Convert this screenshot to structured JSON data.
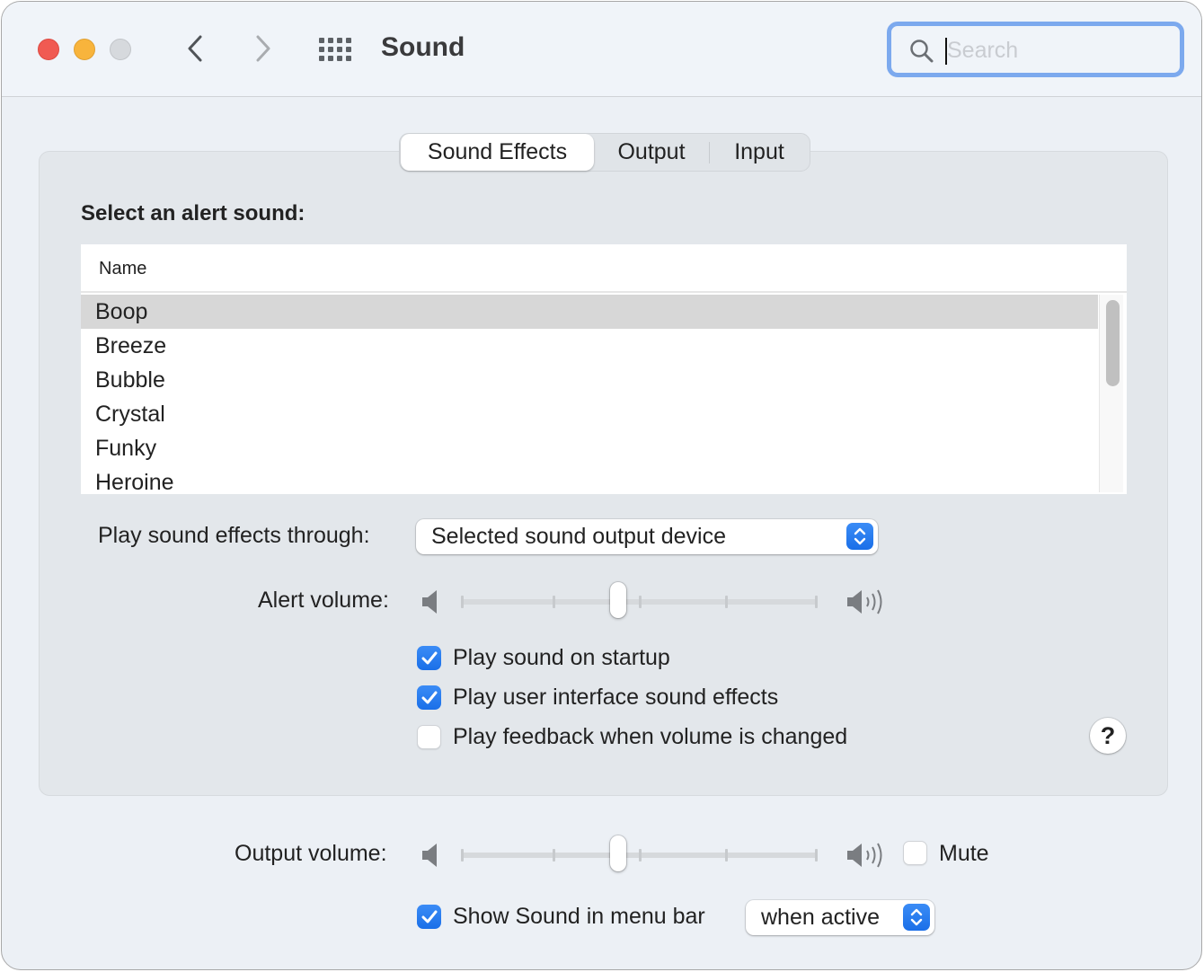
{
  "window": {
    "title": "Sound",
    "search": {
      "placeholder": "Search",
      "value": ""
    }
  },
  "tabs": [
    {
      "label": "Sound Effects",
      "selected": true
    },
    {
      "label": "Output",
      "selected": false
    },
    {
      "label": "Input",
      "selected": false
    }
  ],
  "sound_effects": {
    "section_label": "Select an alert sound:",
    "list": {
      "column_header": "Name",
      "items": [
        "Boop",
        "Breeze",
        "Bubble",
        "Crystal",
        "Funky",
        "Heroine"
      ],
      "selected": "Boop"
    },
    "play_through": {
      "label": "Play sound effects through:",
      "value": "Selected sound output device"
    },
    "alert_volume": {
      "label": "Alert volume:",
      "value_fraction": 0.44
    },
    "checkboxes": [
      {
        "label": "Play sound on startup",
        "checked": true
      },
      {
        "label": "Play user interface sound effects",
        "checked": true
      },
      {
        "label": "Play feedback when volume is changed",
        "checked": false
      }
    ],
    "help_label": "?"
  },
  "output": {
    "volume_label": "Output volume:",
    "volume_fraction": 0.44,
    "mute_label": "Mute",
    "mute_checked": false,
    "show_in_menu_bar": {
      "label": "Show Sound in menu bar",
      "checked": true
    },
    "menu_bar_mode": "when active"
  },
  "colors": {
    "accent": "#1a6fe8",
    "focus_ring": "#7ca9ee",
    "close": "#f05a52",
    "minimize": "#f8b43c",
    "zoom_disabled": "#d6d9dd"
  }
}
